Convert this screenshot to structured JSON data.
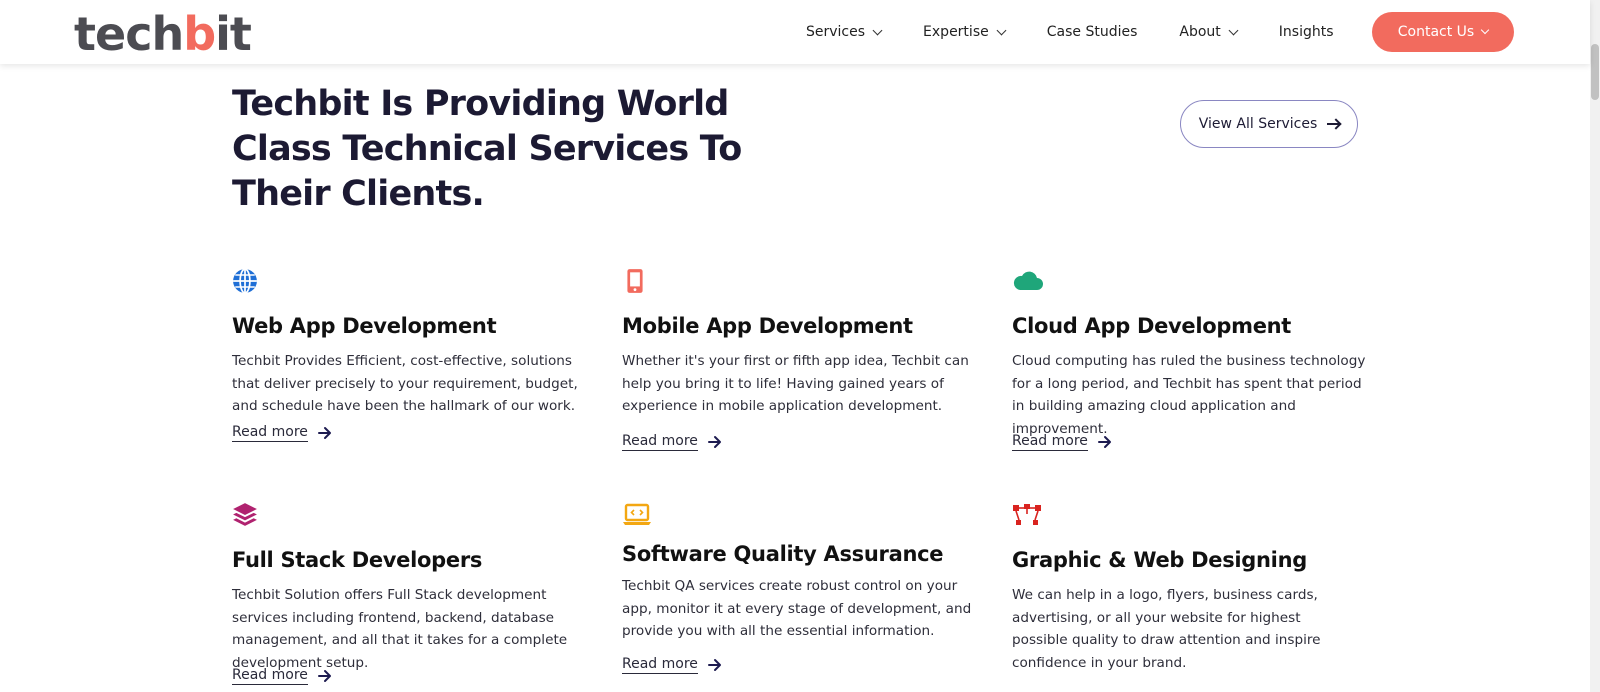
{
  "header": {
    "logo_left": "tech",
    "logo_mark": "b",
    "logo_right": "it",
    "nav": [
      {
        "label": "Services",
        "dropdown": true
      },
      {
        "label": "Expertise",
        "dropdown": true
      },
      {
        "label": "Case Studies",
        "dropdown": false
      },
      {
        "label": "About",
        "dropdown": true
      },
      {
        "label": "Insights",
        "dropdown": false
      }
    ],
    "contact_label": "Contact Us"
  },
  "hero": {
    "title": "Techbit Is Providing World Class Technical Services To Their Clients.",
    "view_all_label": "View All Services"
  },
  "colors": {
    "accent": "#f26b5e",
    "navy": "#1c1a33",
    "icon_web": "#1f6fd6",
    "icon_mobile": "#f26b5e",
    "icon_cloud": "#1fa67a",
    "icon_stack": "#b0226f",
    "icon_qa": "#f3a712",
    "icon_design": "#d9231f"
  },
  "services": [
    {
      "icon": "globe-icon",
      "title": "Web App Development",
      "text": "Techbit Provides Efficient, cost-effective, solutions that deliver precisely to your requirement, budget, and schedule have been the hallmark of our work.",
      "link": "Read more"
    },
    {
      "icon": "mobile-phone-icon",
      "title": "Mobile App Development",
      "text": "Whether it's your first or fifth app idea, Techbit can help you bring it to life! Having gained years of experience in mobile application development.",
      "link": "Read more"
    },
    {
      "icon": "cloud-icon",
      "title": "Cloud App Development",
      "text": "Cloud computing has ruled the business technology for a long period, and Techbit has spent that period in building amazing cloud application and improvement.",
      "link": "Read more"
    },
    {
      "icon": "layers-icon",
      "title": "Full Stack Developers",
      "text": "Techbit Solution offers Full Stack development services including frontend, backend, database management, and all that it takes for a complete development setup.",
      "link": "Read more"
    },
    {
      "icon": "laptop-code-icon",
      "title": "Software Quality Assurance",
      "text": "Techbit QA services create robust control on your app, monitor it at every stage of development, and provide you with all the essential information.",
      "link": "Read more"
    },
    {
      "icon": "vector-design-icon",
      "title": "Graphic & Web Designing",
      "text": "We can help in a logo, flyers, business cards, advertising, or all your website for highest possible quality to draw attention and inspire confidence in your brand.",
      "link": "Read more"
    }
  ]
}
